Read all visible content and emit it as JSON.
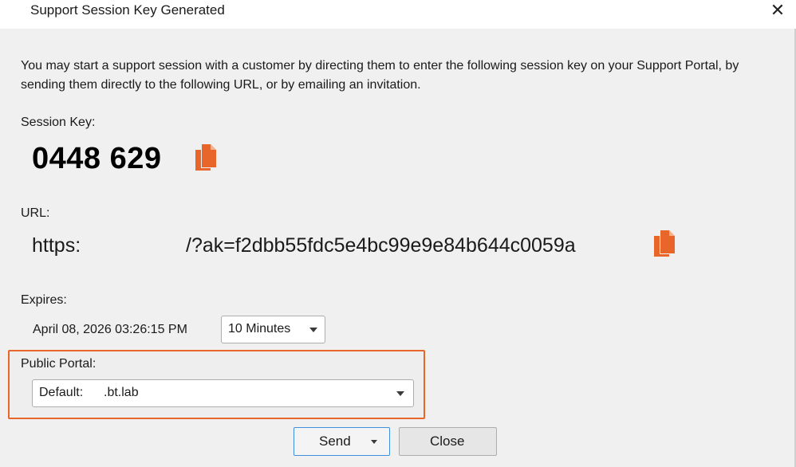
{
  "window": {
    "title": "Support Session Key Generated",
    "close_glyph": "✕"
  },
  "intro_text": "You may start a support session with a customer by directing them to enter the following session key on your Support Portal, by sending them directly to the following URL, or by emailing an invitation.",
  "session_key": {
    "label": "Session Key:",
    "value": "0448 629",
    "copy_icon": "copy-document-icon"
  },
  "url": {
    "label": "URL:",
    "prefix": "https:",
    "suffix": "/?ak=f2dbb55fdc5e4bc99e9e84b644c0059a",
    "copy_icon": "copy-document-icon"
  },
  "expires": {
    "label": "Expires:",
    "date": "April 08, 2026 03:26:15 PM",
    "duration_selected": "10 Minutes"
  },
  "public_portal": {
    "label": "Public Portal:",
    "selected_prefix": "Default:",
    "selected_suffix": ".bt.lab"
  },
  "buttons": {
    "send": "Send",
    "close": "Close"
  },
  "colors": {
    "accent_orange": "#E8662A",
    "focus_blue": "#3F8FDC",
    "dialog_background": "#F0F0F0"
  }
}
